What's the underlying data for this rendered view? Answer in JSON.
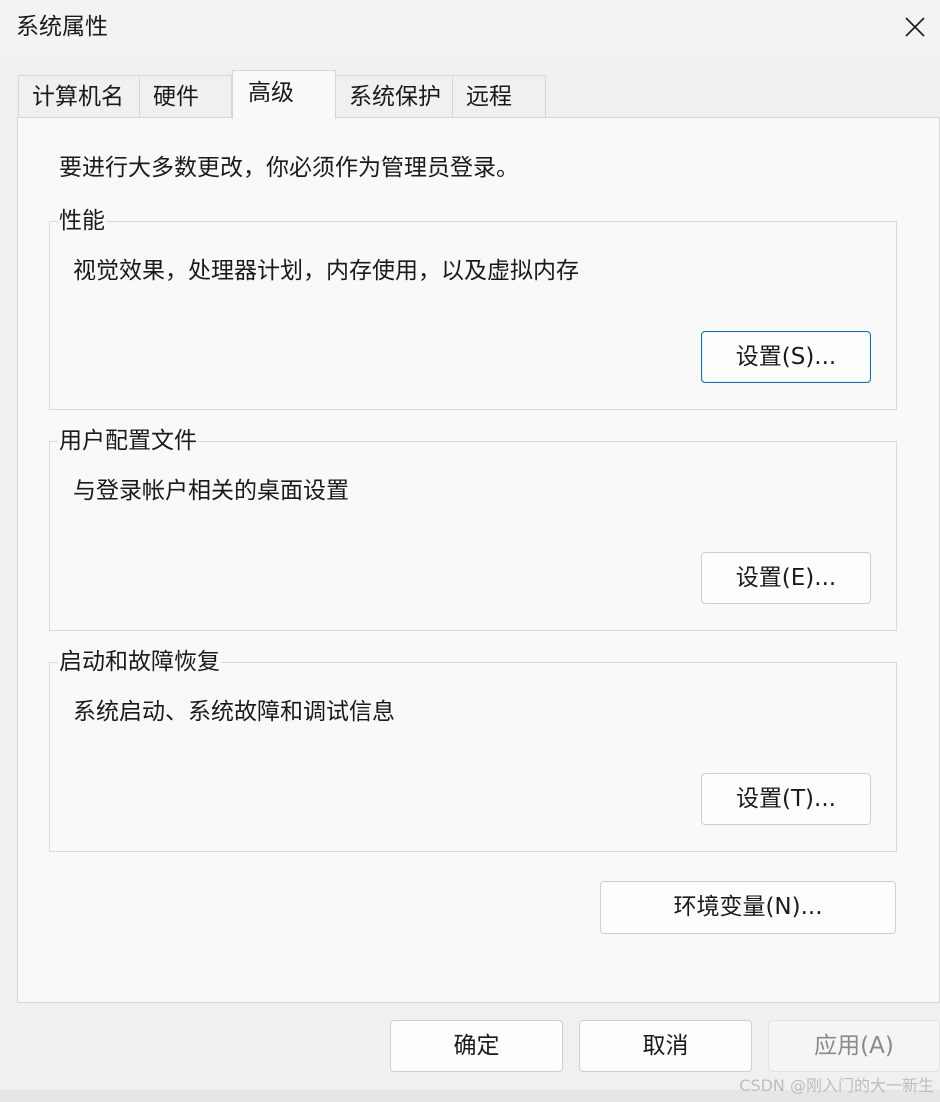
{
  "window": {
    "title": "系统属性"
  },
  "tabs": [
    {
      "label": "计算机名",
      "active": false
    },
    {
      "label": "硬件",
      "active": false
    },
    {
      "label": "高级",
      "active": true
    },
    {
      "label": "系统保护",
      "active": false
    },
    {
      "label": "远程",
      "active": false
    }
  ],
  "panel": {
    "notice": "要进行大多数更改，你必须作为管理员登录。",
    "performance": {
      "title": "性能",
      "description": "视觉效果，处理器计划，内存使用，以及虚拟内存",
      "button": "设置(S)..."
    },
    "user_profiles": {
      "title": "用户配置文件",
      "description": "与登录帐户相关的桌面设置",
      "button": "设置(E)..."
    },
    "startup_recovery": {
      "title": "启动和故障恢复",
      "description": "系统启动、系统故障和调试信息",
      "button": "设置(T)..."
    },
    "env_button": "环境变量(N)..."
  },
  "footer": {
    "ok": "确定",
    "cancel": "取消",
    "apply": "应用(A)"
  },
  "watermark": "CSDN @刚入门的大一新生",
  "icons": {
    "close": "close-icon"
  },
  "colors": {
    "focus_border": "#1b6ea6",
    "panel_bg": "#f9f9f9",
    "window_bg": "#f0f0f0"
  }
}
